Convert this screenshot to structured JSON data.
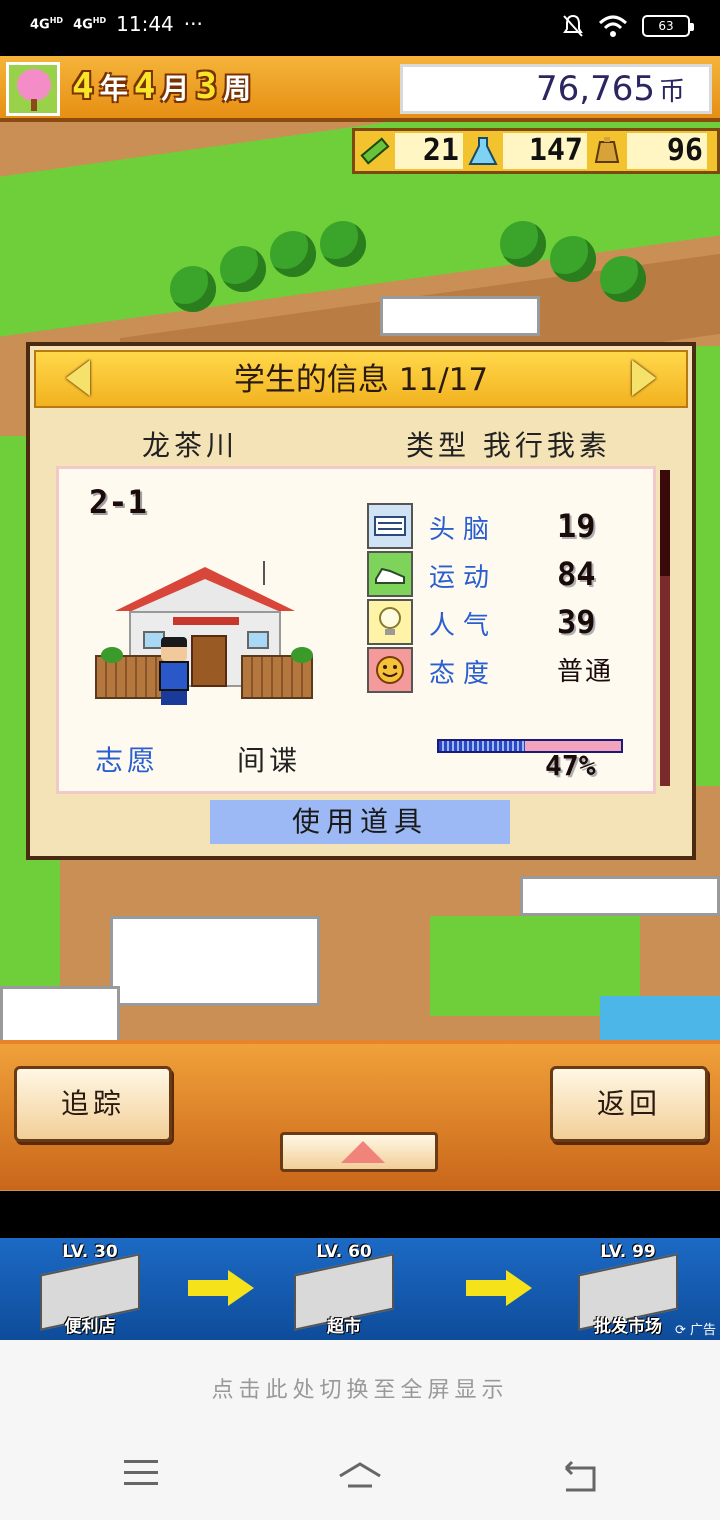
{
  "status_bar": {
    "network1": "4G",
    "network2": "4G",
    "time": "11:44",
    "more": "···",
    "battery": "63"
  },
  "hud": {
    "year": "4",
    "year_unit": "年",
    "month": "4",
    "month_unit": "月",
    "week": "3",
    "week_unit": "周",
    "money": "76,765",
    "currency": "币",
    "resources": [
      {
        "icon": "pencil-icon",
        "value": "21"
      },
      {
        "icon": "flask-icon",
        "value": "147"
      },
      {
        "icon": "bell-icon",
        "value": "96"
      }
    ]
  },
  "dialog": {
    "title": "学生的信息 11/17",
    "student_name": "龙茶川",
    "type_label": "类型 我行我素",
    "class": "2-1",
    "stats": [
      {
        "icon": "brain-icon",
        "label": "头脑",
        "value": "19"
      },
      {
        "icon": "sneaker-icon",
        "label": "运动",
        "value": "84"
      },
      {
        "icon": "lightbulb-icon",
        "label": "人气",
        "value": "39"
      },
      {
        "icon": "smiley-icon",
        "label": "态度",
        "value": "普通"
      }
    ],
    "wish_label": "志愿",
    "wish_value": "间谍",
    "progress_percent": 47,
    "progress_label": "47%",
    "use_item_label": "使用道具"
  },
  "panel": {
    "track_label": "追踪",
    "back_label": "返回"
  },
  "ad": {
    "items": [
      {
        "level": "LV. 30",
        "caption": "便利店"
      },
      {
        "level": "LV. 60",
        "caption": "超市"
      },
      {
        "level": "LV. 99",
        "caption": "批发市场"
      }
    ],
    "tag": "广告"
  },
  "tip": "点击此处切换至全屏显示",
  "colors": {
    "hud_orange": "#e68f14",
    "label_blue": "#2a5fd0",
    "button_blue": "#9db9f5",
    "progress_pink": "#f4a3bd"
  }
}
